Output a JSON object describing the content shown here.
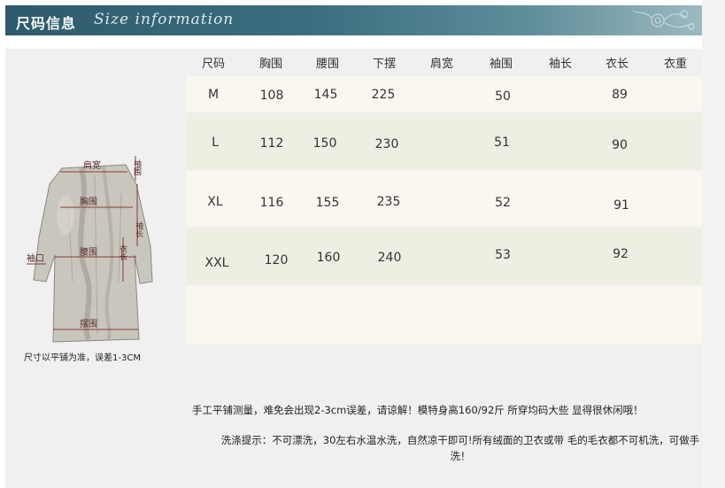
{
  "banner": {
    "title_cn": "尺码信息",
    "title_en": "Size information"
  },
  "table": {
    "headers": [
      "尺码",
      "胸围",
      "腰围",
      "下摆",
      "肩宽",
      "袖围",
      "袖长",
      "衣长",
      "衣重"
    ],
    "rows": [
      [
        "M",
        "108",
        "145",
        "225",
        "",
        "50",
        "",
        "89",
        ""
      ],
      [
        "L",
        "112",
        "150",
        "230",
        "",
        "51",
        "",
        "90",
        ""
      ],
      [
        "XL",
        "116",
        "155",
        "235",
        "",
        "52",
        "",
        "91",
        ""
      ],
      [
        "XXL",
        "120",
        "160",
        "240",
        "",
        "53",
        "",
        "92",
        ""
      ]
    ]
  },
  "figure": {
    "labels": {
      "shoulder": "肩宽",
      "chest": "胸围",
      "waist": "腰围",
      "hem": "摆围",
      "cuff": "袖口",
      "sleeve_width": "袖围",
      "sleeve_length": "袖长",
      "body_length": "衣长"
    },
    "caption": "尺寸以平铺为准，误差1-3CM"
  },
  "notes": {
    "measure": "手工平铺测量，难免会出现2-3cm误差，请谅解！模特身高160/92斤 所穿均码大些  显得很休闲哦！",
    "wash": "洗涤提示：不可漂洗，30左右水温水洗，自然凉干即可!所有绒面的卫衣或带 毛的毛衣都不可机洗，可做手洗！"
  }
}
